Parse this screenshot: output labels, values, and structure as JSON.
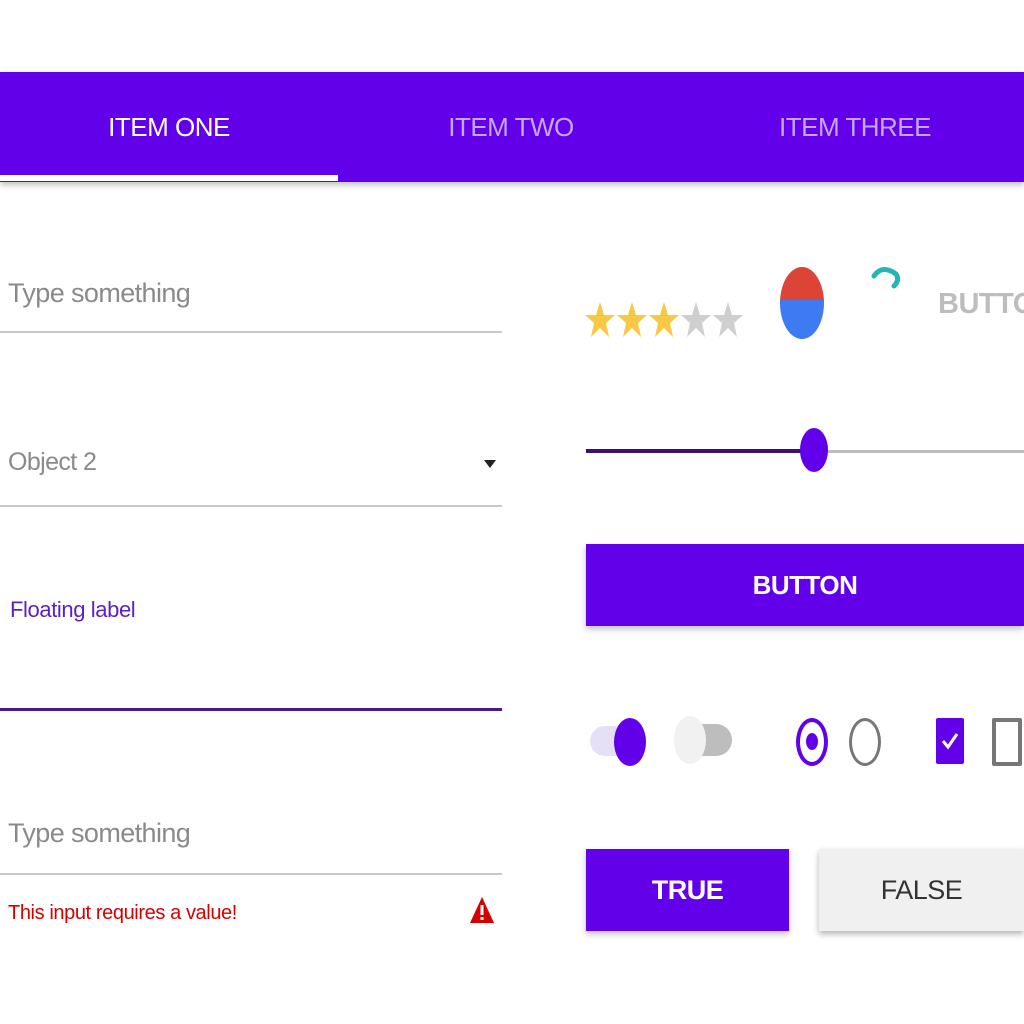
{
  "colors": {
    "primary": "#6200ea",
    "tab_inactive_text": "#c7a6ff",
    "error": "#d50000",
    "star_filled": "#f7c843",
    "star_empty": "#cfcfcf"
  },
  "tabs": [
    {
      "label": "ITEM ONE",
      "active": true
    },
    {
      "label": "ITEM TWO",
      "active": false
    },
    {
      "label": "ITEM THREE",
      "active": false
    }
  ],
  "form": {
    "text_field_1": {
      "placeholder": "Type something"
    },
    "dropdown": {
      "selected": "Object 2",
      "icon": "arrow-drop-down-icon"
    },
    "floating_field": {
      "label": "Floating label"
    },
    "error_field": {
      "placeholder": "Type something",
      "error_message": "This input requires a value!",
      "icon": "warning-icon"
    }
  },
  "controls": {
    "rating": {
      "value": 3,
      "max": 5
    },
    "flat_button_label": "BUTTON",
    "slider": {
      "value": 0.52
    },
    "raised_button_label": "BUTTON",
    "switch_1": {
      "on": true
    },
    "switch_2": {
      "on": false
    },
    "radio_1": {
      "checked": true
    },
    "radio_2": {
      "checked": false
    },
    "checkbox_1": {
      "checked": true
    },
    "checkbox_2": {
      "checked": false
    },
    "toggle_true_label": "TRUE",
    "toggle_false_label": "FALSE"
  }
}
